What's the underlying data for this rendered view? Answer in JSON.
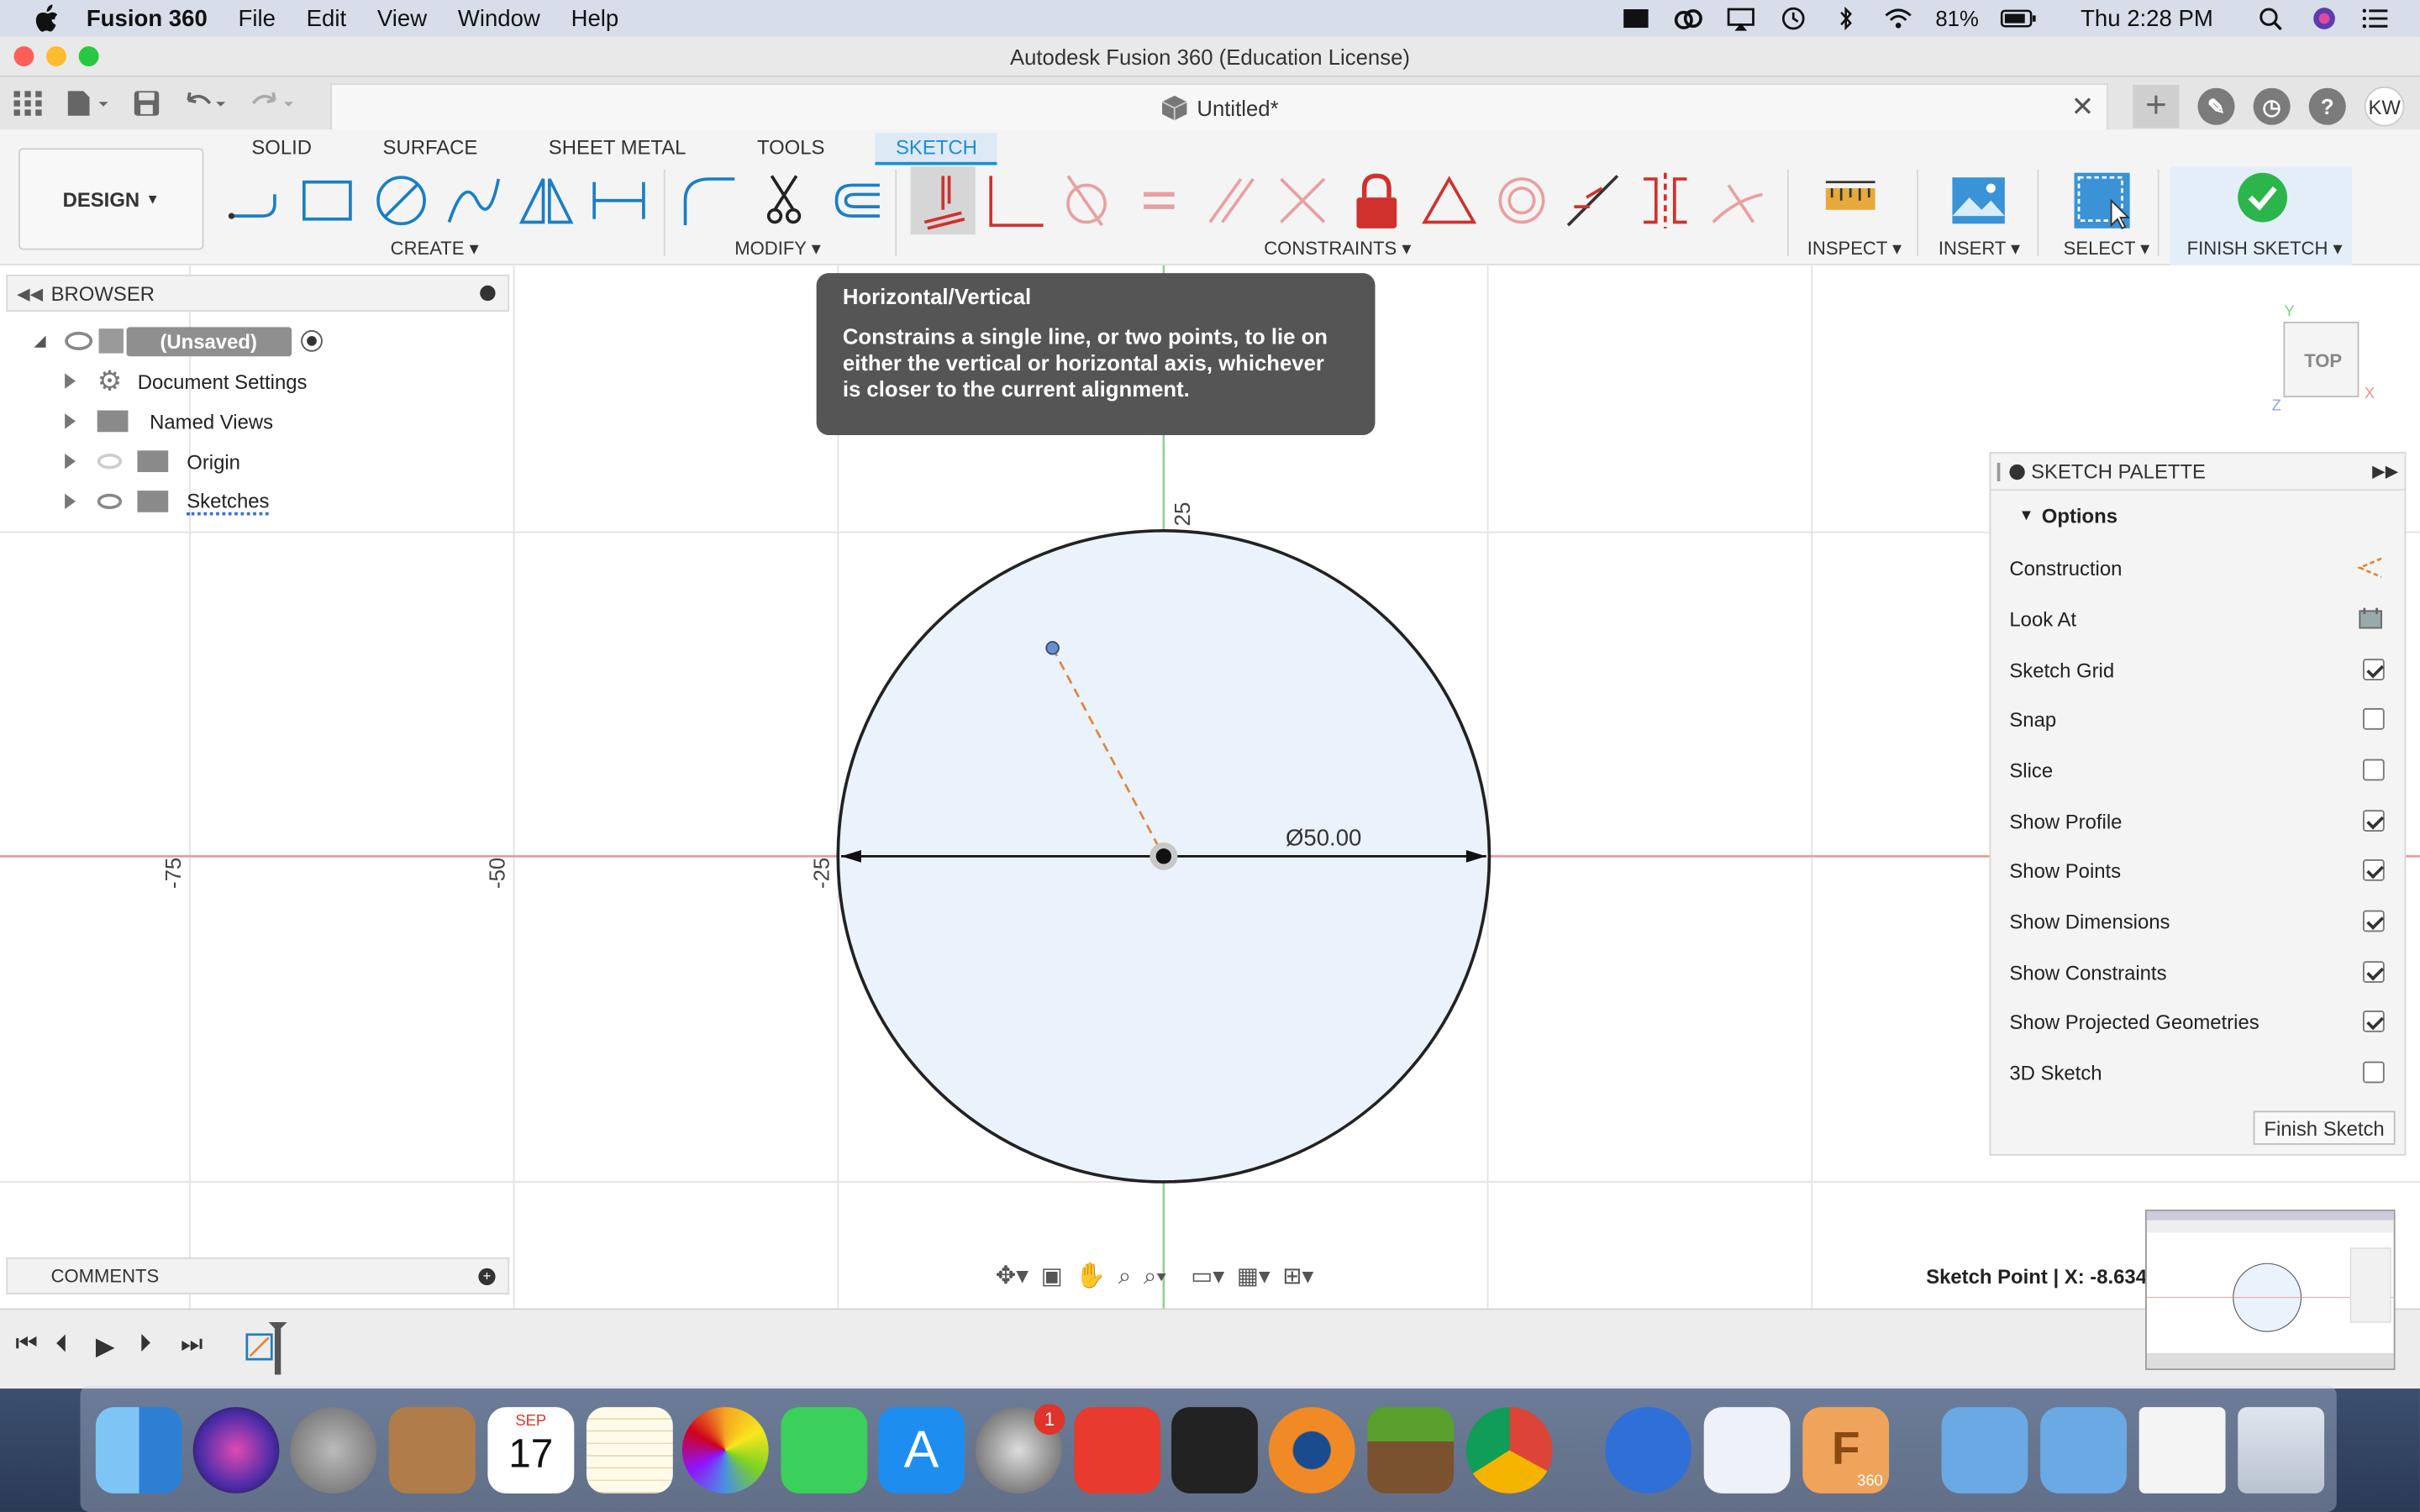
{
  "menubar": {
    "app_name": "Fusion 360",
    "items": [
      "File",
      "Edit",
      "View",
      "Window",
      "Help"
    ],
    "battery": "81%",
    "clock": "Thu 2:28 PM"
  },
  "window": {
    "title": "Autodesk Fusion 360 (Education License)",
    "doc_tab": "Untitled*",
    "avatar": "KW"
  },
  "ribbon": {
    "workspace": "DESIGN",
    "tabs": [
      "SOLID",
      "SURFACE",
      "SHEET METAL",
      "TOOLS",
      "SKETCH"
    ],
    "active_tab": "SKETCH",
    "groups": {
      "create": "CREATE",
      "modify": "MODIFY",
      "constraints": "CONSTRAINTS",
      "inspect": "INSPECT",
      "insert": "INSERT",
      "select": "SELECT",
      "finish": "FINISH SKETCH"
    }
  },
  "browser": {
    "title": "BROWSER",
    "root": "(Unsaved)",
    "items": [
      "Document Settings",
      "Named Views",
      "Origin",
      "Sketches"
    ]
  },
  "tooltip": {
    "title": "Horizontal/Vertical",
    "line1": "Constrains a single line, or two points, to lie on",
    "line2": "either the vertical or horizontal axis, whichever",
    "line3": "is closer to the current alignment."
  },
  "canvas": {
    "axis_labels": [
      "-75",
      "-50",
      "-25",
      "25"
    ],
    "dimension": "Ø50.00",
    "view_cube": "TOP",
    "status": "Sketch Point | X: -8.634"
  },
  "palette": {
    "title": "SKETCH PALETTE",
    "section": "Options",
    "rows": [
      {
        "label": "Construction",
        "type": "icon"
      },
      {
        "label": "Look At",
        "type": "icon"
      },
      {
        "label": "Sketch Grid",
        "type": "checkbox",
        "checked": true
      },
      {
        "label": "Snap",
        "type": "checkbox",
        "checked": false
      },
      {
        "label": "Slice",
        "type": "checkbox",
        "checked": false
      },
      {
        "label": "Show Profile",
        "type": "checkbox",
        "checked": true
      },
      {
        "label": "Show Points",
        "type": "checkbox",
        "checked": true
      },
      {
        "label": "Show Dimensions",
        "type": "checkbox",
        "checked": true
      },
      {
        "label": "Show Constraints",
        "type": "checkbox",
        "checked": true
      },
      {
        "label": "Show Projected Geometries",
        "type": "checkbox",
        "checked": true
      },
      {
        "label": "3D Sketch",
        "type": "checkbox",
        "checked": false
      }
    ],
    "finish_button": "Finish Sketch"
  },
  "comments": {
    "title": "COMMENTS"
  },
  "dock": {
    "calendar_month": "SEP",
    "calendar_day": "17",
    "settings_badge": "1",
    "fusion_label": "360"
  },
  "colors": {
    "accent": "#1a8fd6",
    "circle_fill": "#eaf3fb",
    "x_axis": "#e89494",
    "y_axis": "#8fd08f",
    "construction": "#e0883a",
    "finish_green": "#2bb54a"
  }
}
